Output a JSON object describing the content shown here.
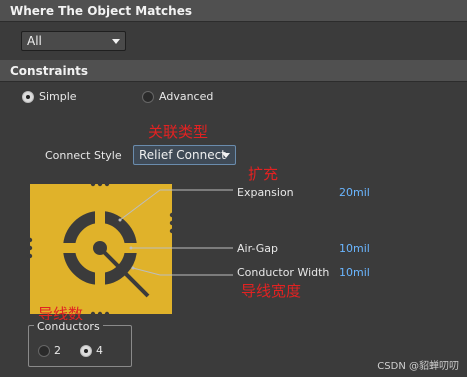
{
  "match_section": {
    "title": "Where The Object Matches"
  },
  "match_dropdown": {
    "value": "All"
  },
  "constraints_section": {
    "title": "Constraints"
  },
  "mode": {
    "simple_label": "Simple",
    "advanced_label": "Advanced",
    "selected": "Simple"
  },
  "connect_style": {
    "label": "Connect Style",
    "value": "Relief Connect",
    "annotation_cn": "关联类型"
  },
  "expansion": {
    "label": "Expansion",
    "value": "20mil",
    "annotation_cn": "扩充"
  },
  "air_gap": {
    "label": "Air-Gap",
    "value": "10mil"
  },
  "conductor_width": {
    "label": "Conductor Width",
    "value": "10mil",
    "annotation_cn": "导线宽度"
  },
  "conductors": {
    "label": "Conductors",
    "annotation_cn": "导线数",
    "option_2": "2",
    "option_4": "4",
    "selected": "4"
  },
  "watermark": "CSDN @貂蝉叨叨",
  "colors": {
    "pad_copper": "#e0b22a",
    "value_text": "#6ab6ff",
    "annotation": "#e12222",
    "background": "#3b3b3b"
  }
}
